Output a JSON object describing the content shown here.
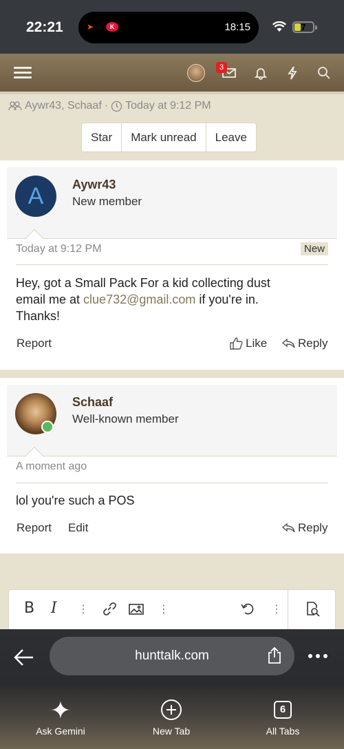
{
  "status_bar": {
    "time": "22:21",
    "activity_time": "18:15",
    "battery": "7"
  },
  "nav": {
    "inbox_count": "3"
  },
  "conversation": {
    "participants": "Aywr43, Schaaf",
    "separator": "·",
    "time": "Today at 9:12 PM",
    "actions": [
      "Star",
      "Mark unread",
      "Leave"
    ]
  },
  "messages": [
    {
      "avatar_letter": "A",
      "username": "Aywr43",
      "user_title": "New member",
      "date": "Today at 9:12 PM",
      "badge": "New",
      "body_pre": "Hey, got a Small Pack For a kid collecting dust email me at ",
      "body_link": "clue732@gmail.com",
      "body_post": " if you're in. Thanks!",
      "report": "Report",
      "like": "Like",
      "reply": "Reply"
    },
    {
      "username": "Schaaf",
      "user_title": "Well-known member",
      "date": "A moment ago",
      "body": "lol you're such a POS",
      "report": "Report",
      "edit": "Edit",
      "reply": "Reply"
    }
  ],
  "editor": {
    "bold": "B",
    "italic": "I"
  },
  "browser": {
    "url": "hunttalk.com",
    "bottom": [
      {
        "label": "Ask Gemini"
      },
      {
        "label": "New Tab"
      },
      {
        "label": "All Tabs",
        "count": "6"
      }
    ]
  }
}
